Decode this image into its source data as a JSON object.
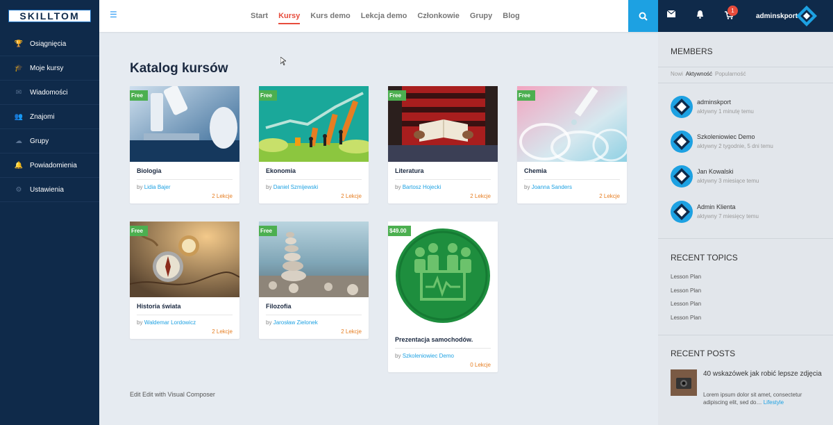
{
  "brand": {
    "logo_text": "SKILLTOM"
  },
  "sidebar": {
    "items": [
      {
        "label": "Osiągnięcia",
        "icon": "trophy-icon"
      },
      {
        "label": "Moje kursy",
        "icon": "graduation-cap-icon"
      },
      {
        "label": "Wiadomości",
        "icon": "envelope-icon"
      },
      {
        "label": "Znajomi",
        "icon": "users-icon"
      },
      {
        "label": "Grupy",
        "icon": "groups-icon"
      },
      {
        "label": "Powiadomienia",
        "icon": "bell-icon"
      },
      {
        "label": "Ustawienia",
        "icon": "gears-icon"
      }
    ]
  },
  "topnav": {
    "items": [
      {
        "label": "Start",
        "active": false
      },
      {
        "label": "Kursy",
        "active": true
      },
      {
        "label": "Kurs demo",
        "active": false
      },
      {
        "label": "Lekcja demo",
        "active": false
      },
      {
        "label": "Członkowie",
        "active": false
      },
      {
        "label": "Grupy",
        "active": false
      },
      {
        "label": "Blog",
        "active": false
      }
    ]
  },
  "user": {
    "name": "adminskport",
    "cart_count": "1"
  },
  "main": {
    "title": "Katalog kursów",
    "edit_link": "Edit Edit with Visual Composer",
    "courses": [
      {
        "price": "Free",
        "title": "Biologia",
        "by": "by",
        "author": "Lidia Bajer",
        "lessons": "2 Lekcje"
      },
      {
        "price": "Free",
        "title": "Ekonomia",
        "by": "by",
        "author": "Daniel Szmijewski",
        "lessons": "2 Lekcje"
      },
      {
        "price": "Free",
        "title": "Literatura",
        "by": "by",
        "author": "Bartosz Hojecki",
        "lessons": "2 Lekcje"
      },
      {
        "price": "Free",
        "title": "Chemia",
        "by": "by",
        "author": "Joanna Sanders",
        "lessons": "2 Lekcje"
      },
      {
        "price": "Free",
        "title": "Historia świata",
        "by": "by",
        "author": "Waldemar Lordowicz",
        "lessons": "2 Lekcje"
      },
      {
        "price": "Free",
        "title": "Filozofia",
        "by": "by",
        "author": "Jarosław Zielonek",
        "lessons": "2 Lekcje"
      },
      {
        "price": "$49.00",
        "title": "Prezentacja samochodów.",
        "by": "by",
        "author": "Szkoleniowiec Demo",
        "lessons": "0 Lekcje"
      }
    ]
  },
  "rightbar": {
    "members_title": "MEMBERS",
    "tabs": [
      "Nowi",
      "Aktywność",
      "Popularność"
    ],
    "active_tab": "Aktywność",
    "members": [
      {
        "name": "adminskport",
        "time": "aktywny 1 minutę temu"
      },
      {
        "name": "Szkoleniowiec Demo",
        "time": "aktywny 2 tygodnie, 5 dni temu"
      },
      {
        "name": "Jan Kowalski",
        "time": "aktywny 3 miesiące temu"
      },
      {
        "name": "Admin Klienta",
        "time": "aktywny 7 miesięcy temu"
      }
    ],
    "topics_title": "RECENT TOPICS",
    "topics": [
      "Lesson Plan",
      "Lesson Plan",
      "Lesson Plan",
      "Lesson Plan"
    ],
    "posts_title": "RECENT POSTS",
    "post": {
      "title": "40 wskazówek jak robić lepsze zdjęcia",
      "excerpt": "Lorem ipsum dolor sit amet, consectetur adipiscing elit, sed do…",
      "category": "Lifestyle"
    }
  },
  "colors": {
    "sidebar": "#0f2a4a",
    "accent": "#1da1e2",
    "active_nav": "#e74c3c",
    "price_tag": "#4caf50"
  }
}
